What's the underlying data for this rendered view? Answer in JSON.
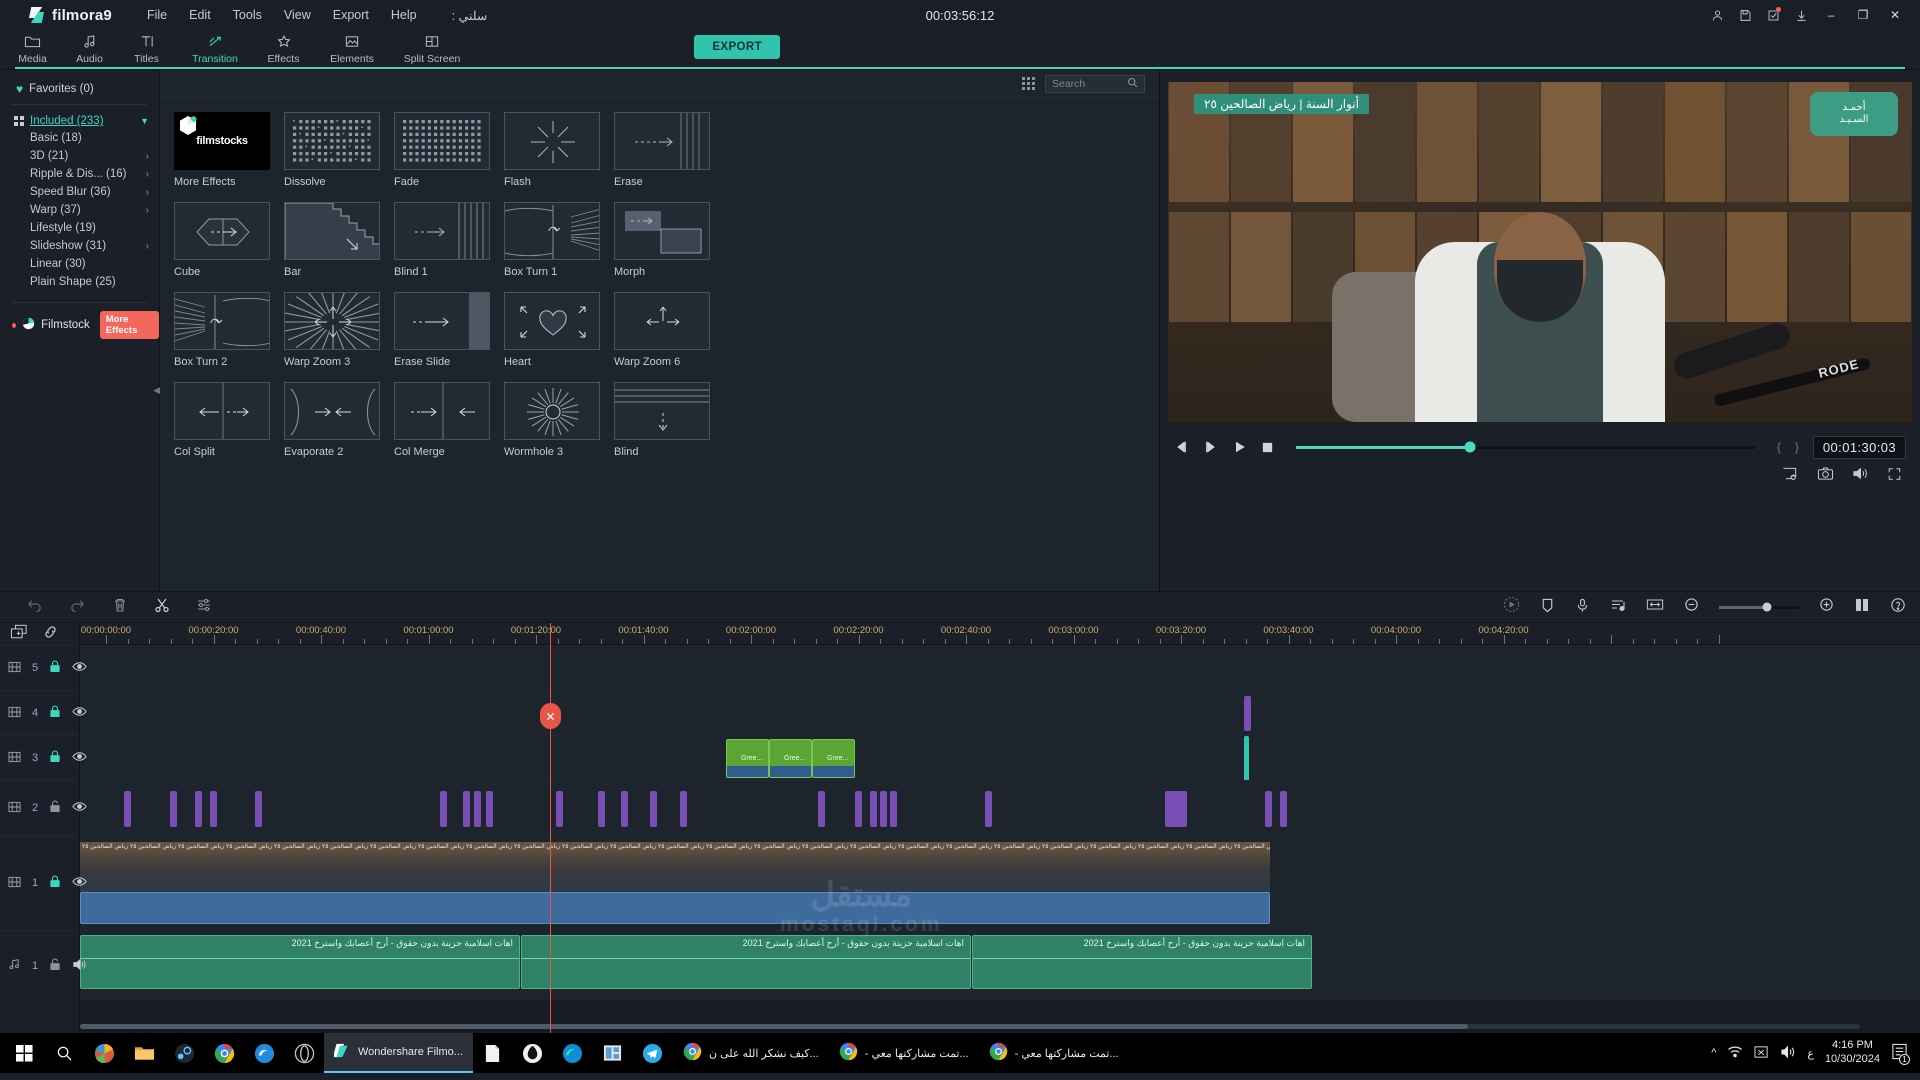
{
  "app": {
    "brand": "filmora",
    "brand_num": "9",
    "project_timecode": "00:03:56:12",
    "project_name": "سلني :"
  },
  "menubar": {
    "items": [
      "File",
      "Edit",
      "Tools",
      "View",
      "Export",
      "Help"
    ],
    "window_icons": [
      "account-icon",
      "save-icon",
      "tasks-icon",
      "download-icon"
    ],
    "minimize": "–",
    "maximize": "❐",
    "close": "✕"
  },
  "ribbon": {
    "tabs": [
      {
        "label": "Media",
        "icon": "folder-icon",
        "active": false
      },
      {
        "label": "Audio",
        "icon": "music-note-icon",
        "active": false
      },
      {
        "label": "Titles",
        "icon": "text-icon",
        "active": false
      },
      {
        "label": "Transition",
        "icon": "transition-icon",
        "active": true
      },
      {
        "label": "Effects",
        "icon": "sparkle-icon",
        "active": false
      },
      {
        "label": "Elements",
        "icon": "image-icon",
        "active": false
      },
      {
        "label": "Split Screen",
        "icon": "split-screen-icon",
        "active": false
      }
    ],
    "export_label": "EXPORT"
  },
  "sidebar": {
    "favorites": "Favorites (0)",
    "root": {
      "label": "Included (233)",
      "expanded": true
    },
    "categories": [
      {
        "label": "Basic (18)",
        "has_arrow": false
      },
      {
        "label": "3D (21)",
        "has_arrow": true
      },
      {
        "label": "Ripple & Dis... (16)",
        "has_arrow": true
      },
      {
        "label": "Speed Blur (36)",
        "has_arrow": true
      },
      {
        "label": "Warp (37)",
        "has_arrow": true
      },
      {
        "label": "Lifestyle (19)",
        "has_arrow": false
      },
      {
        "label": "Slideshow (31)",
        "has_arrow": true
      },
      {
        "label": "Linear (30)",
        "has_arrow": false
      },
      {
        "label": "Plain Shape (25)",
        "has_arrow": false
      }
    ],
    "filmstock": "Filmstock",
    "filmstock_badge": "More Effects"
  },
  "panel": {
    "search_placeholder": "Search",
    "transitions": [
      {
        "label": "More Effects",
        "icon": "filmstocks-logo"
      },
      {
        "label": "Dissolve",
        "icon": "dissolve-icon"
      },
      {
        "label": "Fade",
        "icon": "fade-icon"
      },
      {
        "label": "Flash",
        "icon": "flash-icon"
      },
      {
        "label": "Erase",
        "icon": "erase-icon"
      },
      {
        "label": "Cube",
        "icon": "cube-icon"
      },
      {
        "label": "Bar",
        "icon": "bar-icon"
      },
      {
        "label": "Blind 1",
        "icon": "blind-icon"
      },
      {
        "label": "Box Turn 1",
        "icon": "box-turn-icon"
      },
      {
        "label": "Morph",
        "icon": "morph-icon"
      },
      {
        "label": "Box Turn 2",
        "icon": "box-turn2-icon"
      },
      {
        "label": "Warp Zoom 3",
        "icon": "warp-zoom-icon"
      },
      {
        "label": "Erase Slide",
        "icon": "erase-slide-icon"
      },
      {
        "label": "Heart",
        "icon": "heart-icon"
      },
      {
        "label": "Warp Zoom 6",
        "icon": "warp-zoom6-icon"
      },
      {
        "label": "Col Split",
        "icon": "col-split-icon"
      },
      {
        "label": "Evaporate 2",
        "icon": "evaporate-icon"
      },
      {
        "label": "Col Merge",
        "icon": "col-merge-icon"
      },
      {
        "label": "Wormhole 3",
        "icon": "wormhole-icon"
      },
      {
        "label": "Blind",
        "icon": "blind2-icon"
      }
    ]
  },
  "player": {
    "banner_text": "أنوار السنة | رياض الصالحين ٢٥",
    "logo_line1": "أحمـد",
    "logo_line2": "السـيـد",
    "mic_brand": "RODE",
    "timecode": "00:01:30:03",
    "progress_percent": 38,
    "controls": [
      "prev-frame-button",
      "next-frame-button",
      "play-button",
      "stop-button"
    ],
    "right_controls": [
      "snapshot-settings-icon",
      "camera-icon",
      "volume-icon",
      "fullscreen-icon"
    ],
    "brace_left": "{",
    "brace_right": "}"
  },
  "timeline_toolbar": {
    "left_icons": [
      "undo-icon",
      "redo-icon",
      "delete-icon",
      "split-icon",
      "settings-icon"
    ],
    "right_icons": [
      "render-preview-icon",
      "marker-icon",
      "voiceover-icon",
      "audio-mixer-icon",
      "fit-timeline-icon",
      "zoom-out-icon",
      "zoom-in-icon",
      "split-view-icon",
      "help-icon"
    ],
    "zoom_percent": 60
  },
  "timeline": {
    "add_track_icon": "add-track-icon",
    "link_icon": "link-icon",
    "ruler_labels": [
      "00:00:00:00",
      "00:00:20:00",
      "00:00:40:00",
      "00:01:00:00",
      "00:01:20:00",
      "00:01:40:00",
      "00:02:00:00",
      "00:02:20:00",
      "00:02:40:00",
      "00:03:00:00",
      "00:03:20:00",
      "00:03:40:00",
      "00:04:00:00",
      "00:04:20:00"
    ],
    "tracks": [
      {
        "num": "5",
        "type": "video",
        "locked": true,
        "visible": true
      },
      {
        "num": "4",
        "type": "video",
        "locked": true,
        "visible": true
      },
      {
        "num": "3",
        "type": "video",
        "locked": true,
        "visible": true
      },
      {
        "num": "2",
        "type": "video",
        "locked": false,
        "visible": true
      },
      {
        "num": "1",
        "type": "video",
        "locked": true,
        "visible": true
      },
      {
        "num": "1",
        "type": "audio",
        "locked": false,
        "visible": true
      }
    ],
    "green_clip_labels": [
      "Gree...",
      "Gree...",
      "Gree..."
    ],
    "audio_clip_label": "اهات اسلامية حزينة بدون حقوق  -  أرح أعصابك واسترخ 2021",
    "video_clip_label": "أنوار السنة | رياض الصالحين ٢٥",
    "watermark_line1": "مستقل",
    "watermark_line2": "mostaql.com"
  },
  "taskbar": {
    "start": "start-icon",
    "search": "search-icon",
    "pinned": [
      "task-view-icon",
      "file-explorer-icon",
      "steam-icon",
      "chrome-icon",
      "edge-beta-icon",
      "obs-icon"
    ],
    "apps": [
      {
        "title": "Wondershare Filmo...",
        "icon": "filmora-icon",
        "active": true
      },
      {
        "title": "",
        "icon": "notepad-icon",
        "active": false
      },
      {
        "title": "",
        "icon": "blender-icon",
        "active": false
      },
      {
        "title": "",
        "icon": "edge-icon",
        "active": false
      },
      {
        "title": "",
        "icon": "news-icon",
        "active": false
      },
      {
        "title": "",
        "icon": "telegram-icon",
        "active": false
      },
      {
        "title": "...كيف نشكر الله على ن",
        "icon": "chrome-icon",
        "active": false
      },
      {
        "title": "...تمت مشاركتها معي -",
        "icon": "chrome-icon",
        "active": false
      },
      {
        "title": "...تمت مشاركتها معي -",
        "icon": "chrome-icon",
        "active": false
      }
    ],
    "tray": [
      "chevron-up-icon",
      "wifi-icon",
      "excel-icon",
      "volume-icon"
    ],
    "lang": "ع",
    "time": "4:16 PM",
    "date": "10/30/2024",
    "notification": "notification-icon",
    "notification_count": "1"
  }
}
